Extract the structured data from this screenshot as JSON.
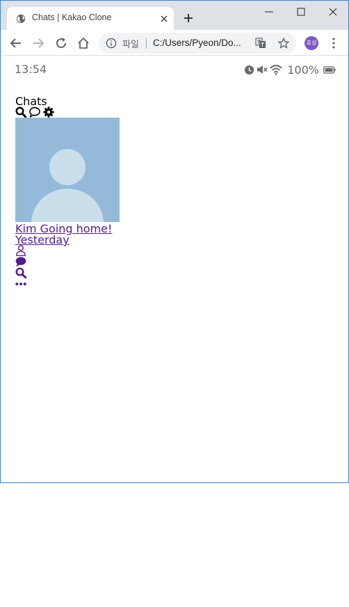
{
  "browser": {
    "tab_title": "Chats | Kakao Clone",
    "url_scheme_label": "파일",
    "url": "C:/Users/Pyeon/Do...",
    "profile_initials": "호성"
  },
  "status": {
    "time": "13:54",
    "battery": "100%"
  },
  "page": {
    "title": "Chats"
  },
  "chats": [
    {
      "name": "Kim",
      "preview": "Going home!",
      "time": "Yesterday"
    }
  ],
  "colors": {
    "link_visited": "#551a8b",
    "avatar_bg": "#95bad9",
    "avatar_fg": "#cadeec",
    "tabstrip": "#dee1e6",
    "omnibox": "#f1f3f4",
    "window_border": "#3c86c8"
  },
  "icons": {
    "header": [
      "search-icon",
      "chat-bubble-icon",
      "gear-icon"
    ],
    "tabbar": [
      "user-icon",
      "chat-bubble-icon",
      "search-icon",
      "more-dots-icon"
    ],
    "status": [
      "alarm-clock-icon",
      "mute-icon",
      "wifi-icon",
      "battery-icon"
    ]
  }
}
